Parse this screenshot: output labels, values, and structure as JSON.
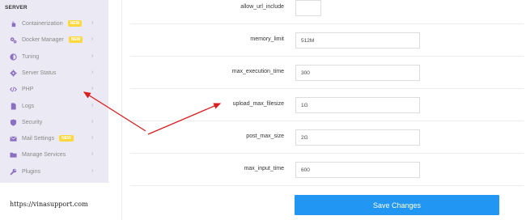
{
  "sidebar": {
    "header": "SERVER",
    "items": [
      {
        "label": "Containerization",
        "badge": "NEW",
        "icon": "hand-icon"
      },
      {
        "label": "Docker Manager",
        "badge": "NEW",
        "icon": "cogs-icon"
      },
      {
        "label": "Tuning",
        "badge": "",
        "icon": "half-circle-icon"
      },
      {
        "label": "Server Status",
        "badge": "",
        "icon": "gear-icon"
      },
      {
        "label": "PHP",
        "badge": "",
        "icon": "code-icon"
      },
      {
        "label": "Logs",
        "badge": "",
        "icon": "file-icon"
      },
      {
        "label": "Security",
        "badge": "",
        "icon": "shield-icon"
      },
      {
        "label": "Mail Settings",
        "badge": "NEW",
        "icon": "envelope-icon"
      },
      {
        "label": "Manage Services",
        "badge": "",
        "icon": "folder-icon"
      },
      {
        "label": "Plugins",
        "badge": "",
        "icon": "wrench-icon"
      }
    ]
  },
  "settings": [
    {
      "label": "allow_url_include",
      "value": ""
    },
    {
      "label": "memory_limit",
      "value": "512M"
    },
    {
      "label": "max_execution_time",
      "value": "300"
    },
    {
      "label": "upload_max_filesize",
      "value": "1G"
    },
    {
      "label": "post_max_size",
      "value": "2G"
    },
    {
      "label": "max_input_time",
      "value": "600"
    }
  ],
  "save_button": "Save Changes",
  "watermark": "https://vinasupport.com",
  "colors": {
    "sidebar_bg": "#ebeaf4",
    "icon_purple": "#8b6fc0",
    "badge_yellow": "#ffd83d",
    "button_blue": "#2196f3",
    "arrow_red": "#d91f1f"
  }
}
